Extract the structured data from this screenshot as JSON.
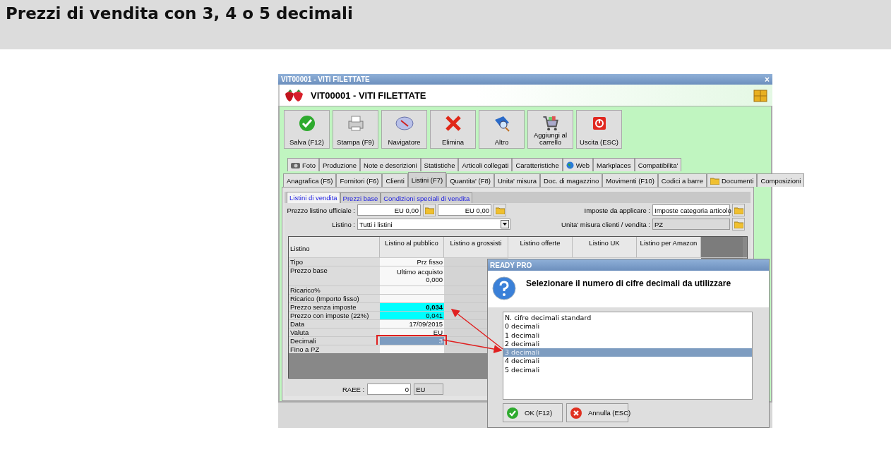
{
  "page_title": "Prezzi di vendita con 3, 4 o 5 decimali",
  "window": {
    "title": "VIT00001 - VITI FILETTATE",
    "close": "×",
    "header": "VIT00001 - VITI FILETTATE"
  },
  "toolbar": [
    {
      "label": "Salva (F12)",
      "kind": "check"
    },
    {
      "label": "Stampa (F9)",
      "kind": "printer"
    },
    {
      "label": "Navigatore",
      "kind": "compass"
    },
    {
      "label": "Elimina",
      "kind": "cross"
    },
    {
      "label": "Altro",
      "kind": "book"
    },
    {
      "label": "Aggiungi al carrello",
      "kind": "cart"
    },
    {
      "label": "Uscita (ESC)",
      "kind": "power"
    }
  ],
  "tabs_top": [
    {
      "label": "Foto",
      "kind": "camera",
      "selected": false
    },
    {
      "label": "Produzione",
      "kind": "text",
      "selected": false
    },
    {
      "label": "Note e descrizioni",
      "kind": "text",
      "selected": false
    },
    {
      "label": "Statistiche",
      "kind": "text",
      "selected": false
    },
    {
      "label": "Articoli collegati",
      "kind": "text",
      "selected": false
    },
    {
      "label": "Caratteristiche",
      "kind": "text",
      "selected": false
    },
    {
      "label": "Web",
      "kind": "globe",
      "selected": false
    },
    {
      "label": "Markplaces",
      "kind": "text",
      "selected": false
    },
    {
      "label": "Compatibilita'",
      "kind": "text",
      "selected": false
    }
  ],
  "tabs_bottom": [
    {
      "label": "Anagrafica (F5)",
      "kind": "text",
      "selected": false
    },
    {
      "label": "Fornitori (F6)",
      "kind": "text",
      "selected": false
    },
    {
      "label": "Clienti",
      "kind": "text",
      "selected": false
    },
    {
      "label": "Listini (F7)",
      "kind": "text",
      "selected": true
    },
    {
      "label": "Quantita' (F8)",
      "kind": "text",
      "selected": false
    },
    {
      "label": "Unita' misura",
      "kind": "text",
      "selected": false
    },
    {
      "label": "Doc. di magazzino",
      "kind": "text",
      "selected": false
    },
    {
      "label": "Movimenti (F10)",
      "kind": "text",
      "selected": false
    },
    {
      "label": "Codici a barre",
      "kind": "text",
      "selected": false
    },
    {
      "label": "Documenti",
      "kind": "folder",
      "selected": false
    },
    {
      "label": "Composizioni",
      "kind": "text",
      "selected": false
    }
  ],
  "subtabs": [
    {
      "label": "Listini di vendita",
      "selected": true
    },
    {
      "label": "Prezzi base",
      "selected": false
    },
    {
      "label": "Condizioni speciali di vendita",
      "selected": false
    }
  ],
  "official_price": {
    "label": "Prezzo listino ufficiale :",
    "value_1": "EU 0,00",
    "value_2": "EU 0,00"
  },
  "listino": {
    "label": "Listino :",
    "value": "Tutti i listini"
  },
  "taxes": {
    "label": "Imposte da applicare :",
    "value": "Imposte categoria articolo"
  },
  "unit": {
    "label": "Unita' misura clienti / vendita :",
    "value": "PZ"
  },
  "table": {
    "columns": [
      "Listino",
      "Listino al pubblico",
      "Listino a grossisti",
      "Listino offerte",
      "Listino UK",
      "Listino per Amazon"
    ],
    "rows": [
      {
        "label": "Tipo",
        "kind": "plain",
        "value": "Prz fisso"
      },
      {
        "label": "Prezzo base",
        "kind": "tall",
        "value": "Ultimo acquisto",
        "value_2": "0,000"
      },
      {
        "label": "Ricarico%",
        "kind": "plain"
      },
      {
        "label": "Ricarico (Importo fisso)",
        "kind": "plain"
      },
      {
        "label": "Prezzo senza imposte",
        "kind": "highlight",
        "value": "0,034",
        "bold": true
      },
      {
        "label": "Prezzo con imposte (22%)",
        "kind": "highlight",
        "value": "0,041"
      },
      {
        "label": "Data",
        "kind": "plain",
        "value": "17/09/2015"
      },
      {
        "label": "Valuta",
        "kind": "plain",
        "value": "EU"
      },
      {
        "label": "Decimali",
        "kind": "selected",
        "value": "3"
      },
      {
        "label": "Fino a PZ",
        "kind": "plain"
      }
    ]
  },
  "raee": {
    "label": "RAEE :",
    "value": "0",
    "unit": "EU"
  },
  "dialog": {
    "title": "READY PRO",
    "question": "Selezionare il numero di cifre decimali da utilizzare",
    "options": [
      {
        "label": "N. cifre decimali standard",
        "selected": false
      },
      {
        "label": "0 decimali",
        "selected": false
      },
      {
        "label": "1 decimali",
        "selected": false
      },
      {
        "label": "2 decimali",
        "selected": false
      },
      {
        "label": "3 decimali",
        "selected": true
      },
      {
        "label": "4 decimali",
        "selected": false
      },
      {
        "label": "5 decimali",
        "selected": false
      }
    ],
    "buttons": [
      {
        "label": "OK (F12)",
        "kind": "ok"
      },
      {
        "label": "Annulla (ESC)",
        "kind": "cancel"
      }
    ]
  }
}
